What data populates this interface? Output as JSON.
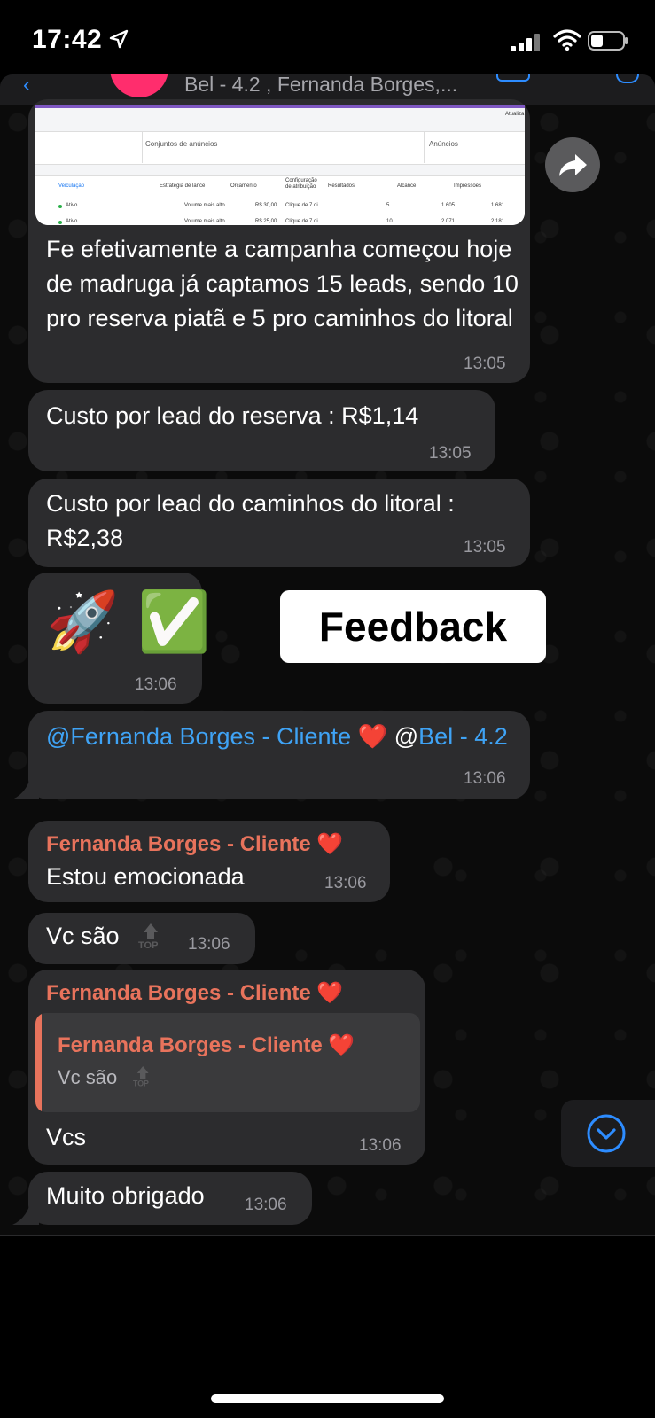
{
  "status_bar": {
    "time": "17:42"
  },
  "header": {
    "title": "Bel - 4.2 , Fernanda Borges,..."
  },
  "image_preview": {
    "corner_text": "Atualiza",
    "tab_left": "Conjuntos de anúncios",
    "tab_right": "Anúncios",
    "columns": [
      "Veiculação",
      "Estratégia de lance",
      "Orçamento",
      "Configuração de atribuição",
      "Resultados",
      "Alcance",
      "Impressões"
    ],
    "rows": [
      [
        "Ativo",
        "Volume mais alto",
        "R$ 30,00",
        "Clique de 7 di...",
        "5",
        "1.605",
        "1.681"
      ],
      [
        "Ativo",
        "Volume mais alto",
        "R$ 25,00",
        "Clique de 7 di...",
        "10",
        "2.071",
        "2.181"
      ]
    ]
  },
  "messages": [
    {
      "text": "Fe efetivamente a campanha começou hoje de madruga já captamos 15 leads, sendo 10 pro reserva piatã e 5 pro caminhos do litoral",
      "time": "13:05"
    },
    {
      "text": "Custo por lead do reserva : R$1,14",
      "time": "13:05"
    },
    {
      "text": "Custo por lead do caminhos do litoral : R$2,38",
      "time": "13:05"
    },
    {
      "emoji": "🚀 ✅",
      "time": "13:06"
    },
    {
      "mention1": "@Fernanda Borges - Cliente",
      "heart": "❤️",
      "mention2_prefix": "@",
      "mention2": "Bel - 4.2",
      "time": "13:06"
    },
    {
      "sender": "Fernanda Borges - Cliente ❤️",
      "text": "Estou emocionada",
      "time": "13:06"
    },
    {
      "text": "Vc são",
      "time": "13:06"
    },
    {
      "sender": "Fernanda Borges - Cliente ❤️",
      "quote_sender": "Fernanda Borges - Cliente ❤️",
      "quote_text": "Vc são",
      "text": "Vcs",
      "time": "13:06"
    },
    {
      "text": "Muito obrigado",
      "time": "13:06"
    }
  ],
  "sticker": {
    "text": "Feedback"
  },
  "top_icon_label": "TOP",
  "icons": {
    "forward": "forward-arrow-icon",
    "scroll_down": "chevron-down-circle-icon"
  },
  "colors": {
    "mention": "#3fa3f5",
    "sender": "#e8735c",
    "bubble": "#2c2c2e",
    "accent": "#2d8cff"
  }
}
